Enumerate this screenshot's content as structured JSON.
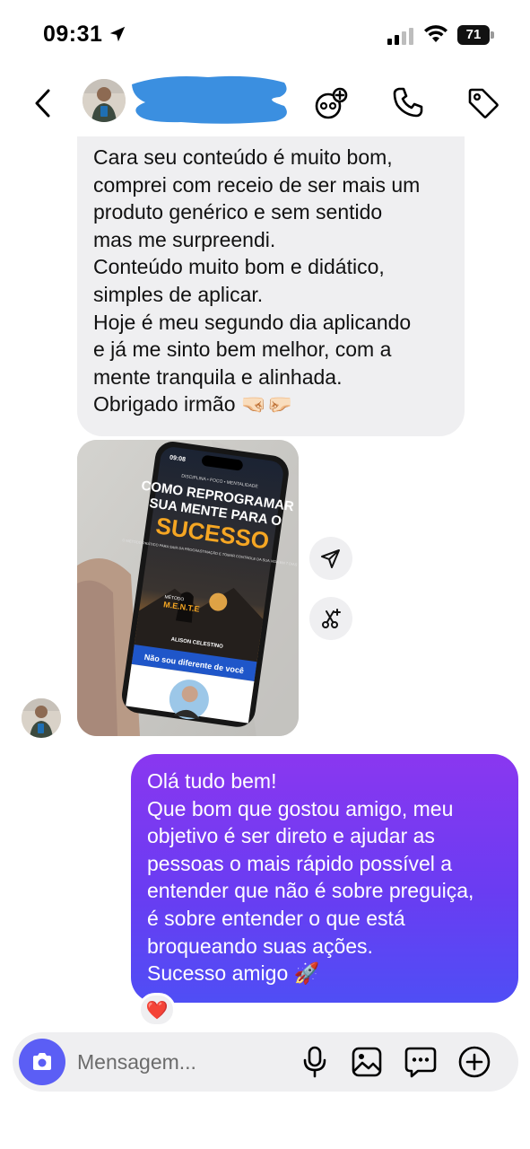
{
  "status_bar": {
    "time": "09:31",
    "battery": "71"
  },
  "header": {
    "contact_name": ""
  },
  "incoming_message": {
    "lines": [
      "Cara seu conteúdo é muito bom,",
      "comprei com receio de ser mais um",
      "produto genérico e sem sentido",
      "mas me surpreendi.",
      "Conteúdo muito bom e didático,",
      "simples de aplicar.",
      "Hoje é meu segundo dia aplicando",
      "e já me sinto bem melhor, com a",
      "mente tranquila e alinhada.",
      "Obrigado irmão 🤜🏻🤛🏻"
    ]
  },
  "photo": {
    "phone_time": "09:08",
    "tagline": "DISCIPLINA • FOCO • MENTALIDADE",
    "title_line1": "COMO REPROGRAMAR",
    "title_line2": "SUA MENTE PARA O",
    "title_line3": "SUCESSO",
    "subtitle": "O MÉTODO PRÁTICO PARA SAIR DA PROCRASTINAÇÃO E TOMAR CONTROLE DA SUA VIDA EM 7 DIAS",
    "method_label": "MÉTODO",
    "method_name": "M.E.N.T.E",
    "author": "ALISON CELESTINO",
    "banner": "Não sou diferente de você"
  },
  "outgoing_message": {
    "lines": [
      "Olá tudo bem!",
      "Que bom que gostou amigo, meu",
      "objetivo é ser direto e ajudar as",
      "pessoas o mais rápido possível a",
      "entender que não é sobre preguiça,",
      "é sobre entender o que está",
      "broqueando suas ações.",
      "Sucesso amigo 🚀"
    ]
  },
  "reaction": {
    "emoji": "❤️"
  },
  "composer": {
    "placeholder": "Mensagem..."
  },
  "colors": {
    "incoming_bubble": "#efeff1",
    "outgoing_gradient_top": "#8a37f0",
    "outgoing_gradient_bottom": "#4f4ef5",
    "camera_button": "#5b5ef5"
  },
  "icons": {
    "header": [
      "back-icon",
      "video-call-icon",
      "phone-icon",
      "tag-icon"
    ],
    "side": [
      "share-icon",
      "edit-icon"
    ],
    "composer": [
      "camera-icon",
      "mic-icon",
      "gallery-icon",
      "sticker-icon",
      "plus-icon"
    ]
  }
}
